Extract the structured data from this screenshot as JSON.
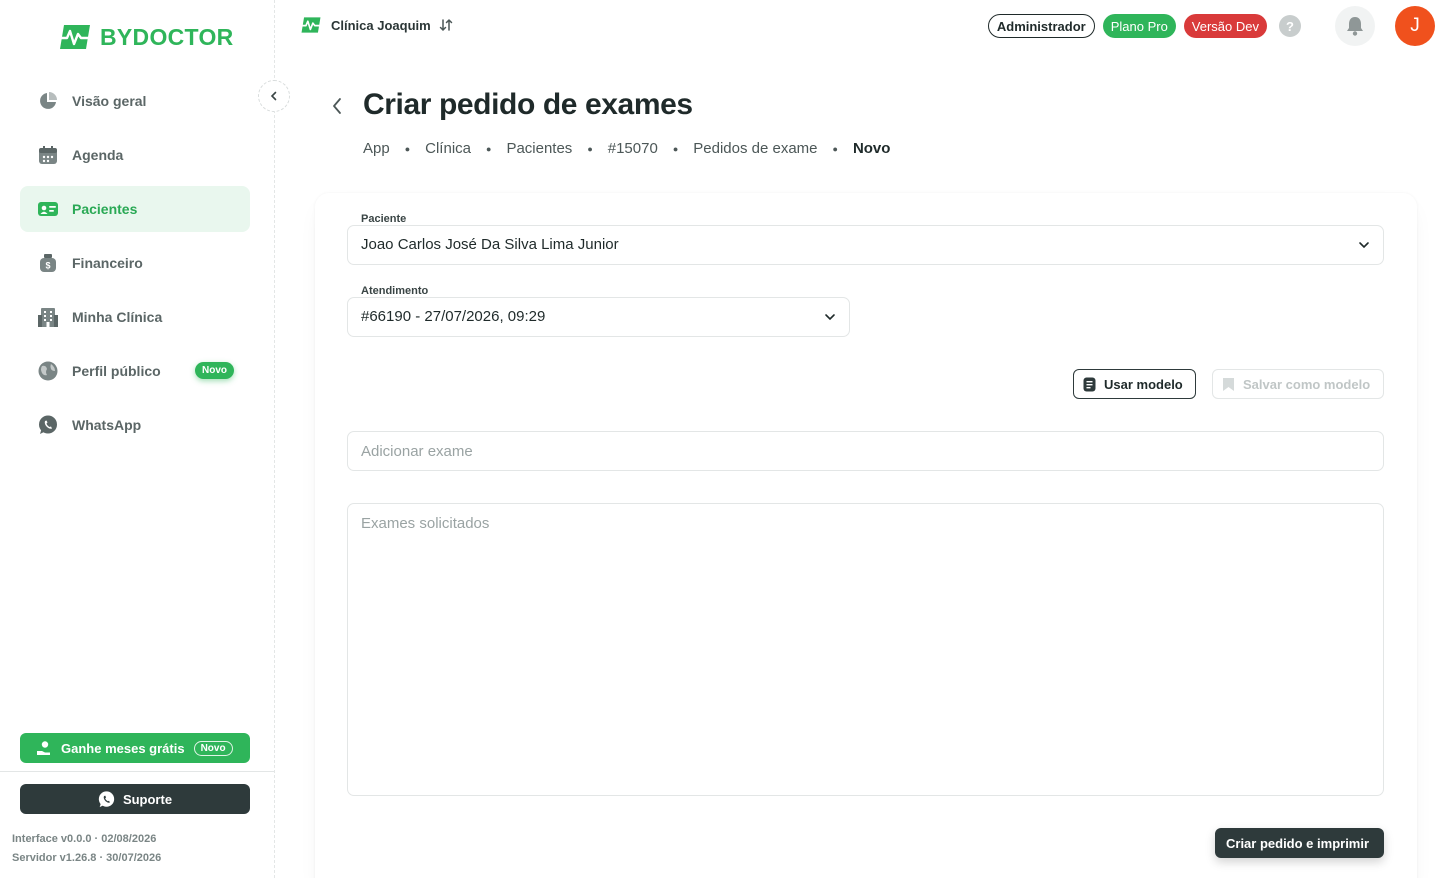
{
  "brand": {
    "name": "BYDOCTOR"
  },
  "sidebar": {
    "items": [
      {
        "label": "Visão geral",
        "icon": "pie-chart-icon"
      },
      {
        "label": "Agenda",
        "icon": "calendar-icon"
      },
      {
        "label": "Pacientes",
        "icon": "id-card-icon",
        "active": true
      },
      {
        "label": "Financeiro",
        "icon": "money-bag-icon"
      },
      {
        "label": "Minha Clínica",
        "icon": "building-icon"
      },
      {
        "label": "Perfil público",
        "icon": "globe-icon",
        "badge": "Novo"
      },
      {
        "label": "WhatsApp",
        "icon": "whatsapp-icon"
      }
    ],
    "promo": {
      "label": "Ganhe meses grátis",
      "badge": "Novo"
    },
    "support_label": "Suporte",
    "interface_version": "Interface v0.0.0 · 02/08/2026",
    "server_version": "Servidor v1.26.8 · 30/07/2026"
  },
  "topbar": {
    "clinic_name": "Clínica Joaquim",
    "role_badge": "Administrador",
    "plan_badge": "Plano Pro",
    "version_badge": "Versão Dev",
    "help_label": "?",
    "avatar_initial": "J"
  },
  "header": {
    "title": "Criar pedido de exames",
    "breadcrumb": [
      "App",
      "Clínica",
      "Pacientes",
      "#15070",
      "Pedidos de exame"
    ],
    "breadcrumb_current": "Novo"
  },
  "form": {
    "patient_label": "Paciente",
    "patient_value": "Joao Carlos José Da Silva Lima Junior",
    "appointment_label": "Atendimento",
    "appointment_value": "#66190 - 27/07/2026, 09:29",
    "use_template_label": "Usar modelo",
    "save_template_label": "Salvar como modelo",
    "add_exam_placeholder": "Adicionar exame",
    "requested_exams_placeholder": "Exames solicitados",
    "submit_label": "Criar pedido e imprimir"
  },
  "colors": {
    "brand_green": "#2fb55a",
    "dark": "#2e3a3b",
    "danger": "#d93a3a",
    "avatar": "#f0511d"
  }
}
